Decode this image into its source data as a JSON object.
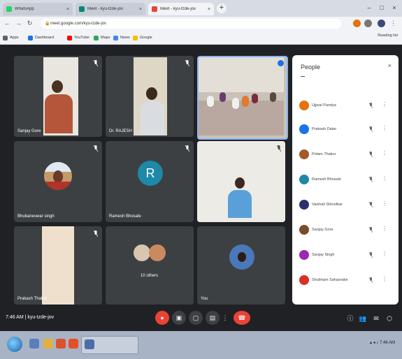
{
  "browser": {
    "tabs": [
      {
        "title": "WhatsApp",
        "color": "#25d366",
        "active": false
      },
      {
        "title": "Meet - kyu-tzde-jov",
        "color": "#00897b",
        "active": false
      },
      {
        "title": "Meet - kyu-tzde-jov",
        "color": "#ea4335",
        "active": true
      }
    ],
    "new_tab": "+",
    "url": "meet.google.com/kyu-tzde-jov",
    "bookmarks": [
      "Apps",
      "Dashboard",
      "YouTube",
      "Maps",
      "News",
      "Google"
    ],
    "reading_list": "Reading list"
  },
  "meet": {
    "tiles": [
      {
        "name": "Sanjay Gore",
        "kind": "video"
      },
      {
        "name": "Dr. RAJESH",
        "kind": "video"
      },
      {
        "name": "",
        "kind": "video-room"
      },
      {
        "name": "Bhubaneswar singh",
        "kind": "photo"
      },
      {
        "name": "Ramesh Bhosale",
        "kind": "letter",
        "letter": "R",
        "color": "#1e88a8"
      },
      {
        "name": "",
        "kind": "video"
      },
      {
        "name": "Prakash Thakur",
        "kind": "video"
      },
      {
        "name": "10 others",
        "kind": "others"
      },
      {
        "name": "You",
        "kind": "self"
      }
    ],
    "people_panel": {
      "title": "People",
      "participants": [
        {
          "name": "Ujjwal Pandya",
          "color": "#e8710a"
        },
        {
          "name": "Prakash Datar",
          "color": "#1a73e8"
        },
        {
          "name": "Pritam Thakur",
          "color": "#a05a2c"
        },
        {
          "name": "Ramesh Bhosale",
          "color": "#1e88a8"
        },
        {
          "name": "Vaishali Shirodkar",
          "color": "#2b2f6b"
        },
        {
          "name": "Sanjay Gore",
          "color": "#7a4b2a"
        },
        {
          "name": "Sanjay Singh",
          "color": "#9c27b0"
        },
        {
          "name": "Shubham Sahasrabe",
          "color": "#d93025"
        }
      ]
    },
    "time": "7:46 AM",
    "meeting_code": "kyu-tzde-jov"
  },
  "taskbar": {
    "tray_time": "7:46 AM"
  }
}
